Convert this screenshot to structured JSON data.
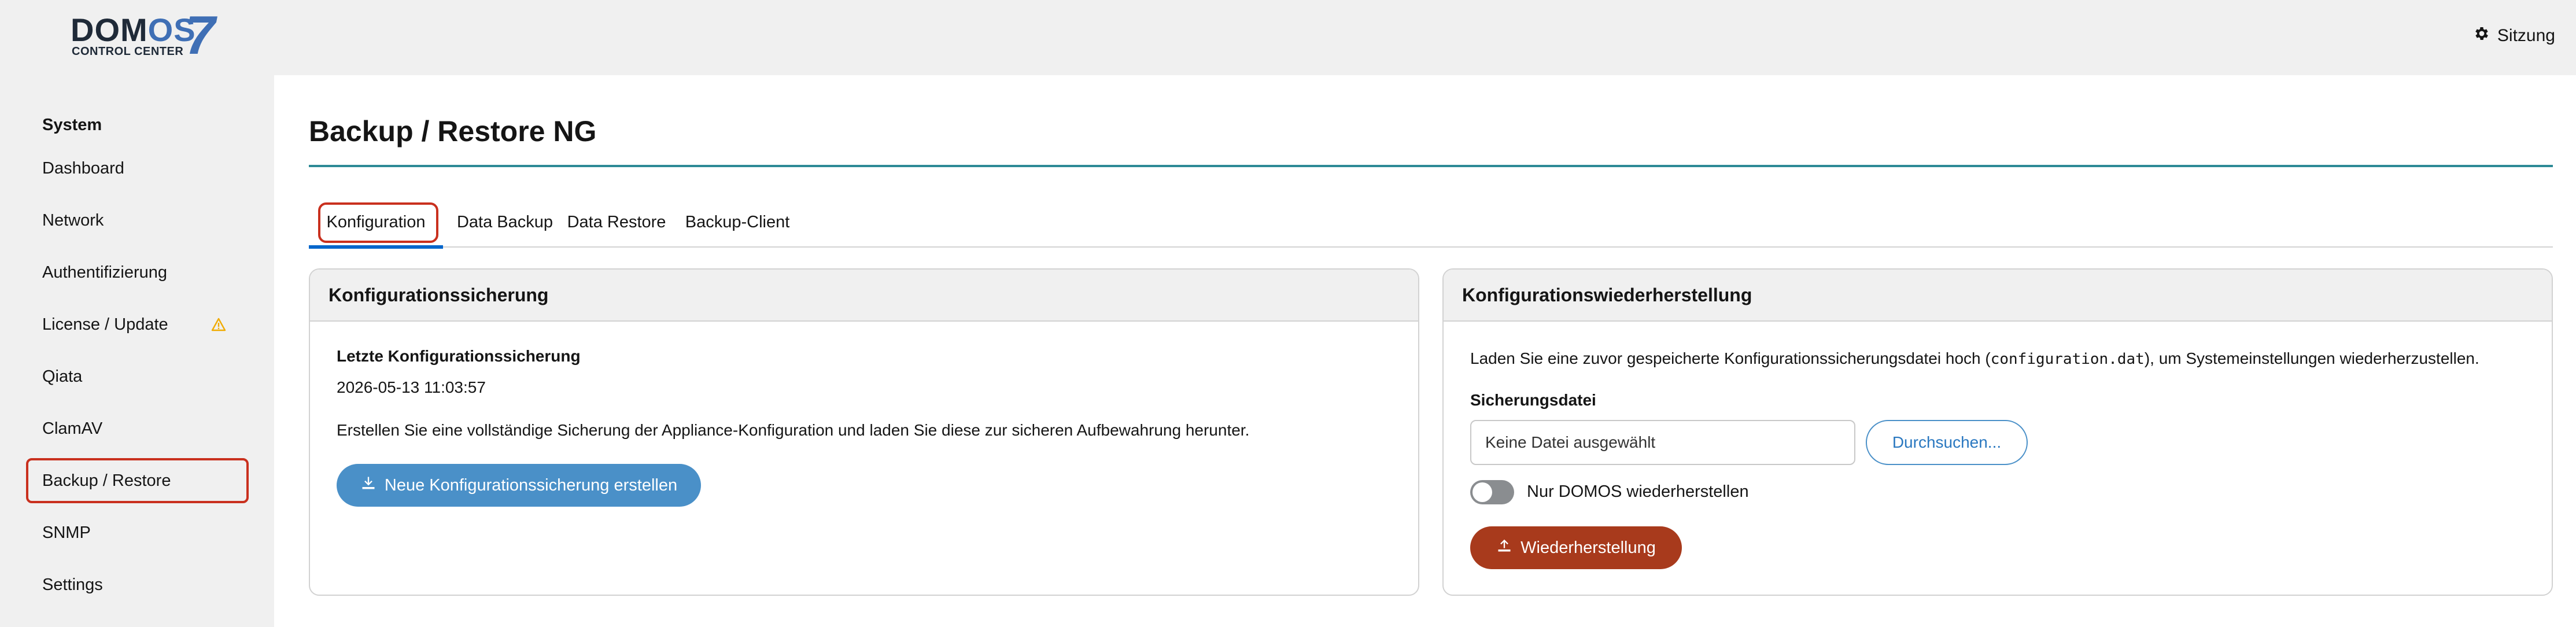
{
  "header": {
    "logo_main": "DOM",
    "logo_os": "OS",
    "logo_seven": "7",
    "logo_sub": "CONTROL CENTER",
    "session_label": "Sitzung",
    "session_icon": "gear-icon"
  },
  "sidebar": {
    "section_title": "System",
    "items": [
      {
        "label": "Dashboard"
      },
      {
        "label": "Network"
      },
      {
        "label": "Authentifizierung"
      },
      {
        "label": "License / Update",
        "badge_icon": "warning-icon"
      },
      {
        "label": "Qiata"
      },
      {
        "label": "ClamAV"
      },
      {
        "label": "Backup / Restore",
        "active": true
      },
      {
        "label": "SNMP"
      },
      {
        "label": "Settings"
      }
    ]
  },
  "main": {
    "title": "Backup / Restore NG",
    "tabs": [
      {
        "label": "Konfiguration",
        "active": true
      },
      {
        "label": "Data Backup"
      },
      {
        "label": "Data Restore"
      },
      {
        "label": "Backup-Client"
      }
    ],
    "backup_card": {
      "title": "Konfigurationssicherung",
      "last_label": "Letzte Konfigurationssicherung",
      "last_value": "2026-05-13 11:03:57",
      "description": "Erstellen Sie eine vollständige Sicherung der Appliance-Konfiguration und laden Sie diese zur sicheren Aufbewahrung herunter.",
      "button_label": "Neue Konfigurationssicherung erstellen",
      "button_icon": "download-icon"
    },
    "restore_card": {
      "title": "Konfigurationswiederherstellung",
      "description_before": "Laden Sie eine zuvor gespeicherte Konfigurationssicherungsdatei hoch (",
      "description_code": "configuration.dat",
      "description_after": "), um Systemeinstellungen wiederherzustellen.",
      "file_label": "Sicherungsdatei",
      "file_value": "Keine Datei ausgewählt",
      "browse_label": "Durchsuchen...",
      "toggle_label": "Nur DOMOS wiederherstellen",
      "toggle_on": false,
      "restore_button_label": "Wiederherstellung",
      "restore_button_icon": "upload-icon"
    }
  },
  "colors": {
    "accent_blue": "#4a90c8",
    "restore_red": "#a83a1c",
    "highlight_red": "#c9301e",
    "title_rule": "#2d8a96"
  }
}
